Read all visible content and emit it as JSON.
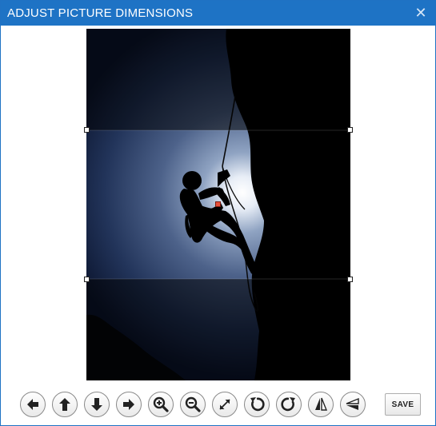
{
  "dialog": {
    "title": "ADJUST PICTURE DIMENSIONS",
    "close_glyph": "✕"
  },
  "image": {
    "description_icon": "rock-climber-silhouette-photo"
  },
  "toolbar": {
    "buttons": [
      {
        "name": "move-left-button",
        "icon": "arrow-left-icon"
      },
      {
        "name": "move-up-button",
        "icon": "arrow-up-icon"
      },
      {
        "name": "move-down-button",
        "icon": "arrow-down-icon"
      },
      {
        "name": "move-right-button",
        "icon": "arrow-right-icon"
      },
      {
        "name": "zoom-in-button",
        "icon": "zoom-in-icon"
      },
      {
        "name": "zoom-out-button",
        "icon": "zoom-out-icon"
      },
      {
        "name": "fit-button",
        "icon": "expand-icon"
      },
      {
        "name": "rotate-left-button",
        "icon": "rotate-ccw-icon"
      },
      {
        "name": "rotate-right-button",
        "icon": "rotate-cw-icon"
      },
      {
        "name": "flip-horizontal-button",
        "icon": "flip-horizontal-icon"
      },
      {
        "name": "flip-vertical-button",
        "icon": "flip-vertical-icon"
      }
    ],
    "save_label": "SAVE"
  },
  "colors": {
    "titlebar": "#1e73c5",
    "title_text": "#ffffff",
    "handle_accent": "#e8503a"
  }
}
